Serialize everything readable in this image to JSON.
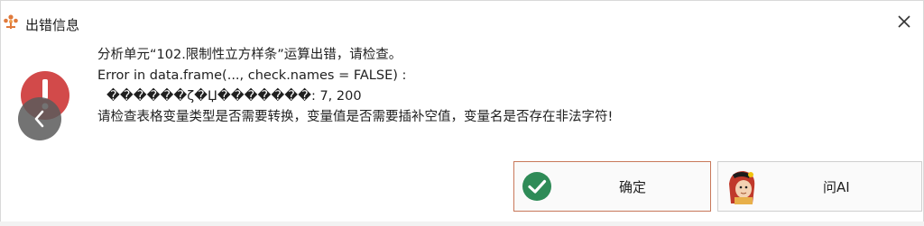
{
  "window": {
    "title": "出错信息"
  },
  "icons": {
    "app": "app-logo-icon",
    "close": "close-icon",
    "error": "error-icon",
    "ok": "checkmark-icon",
    "ai": "mascot-icon"
  },
  "message": {
    "line1": "分析单元“102.限制性立方样条”运算出错，请检查。",
    "line2": "Error in data.frame(..., check.names = FALSE) :",
    "line3": "������ζ�Џ�������: 7, 200",
    "line4": "请检查表格变量类型是否需要转换，变量值是否需要插补空值，变量名是否存在非法字符!"
  },
  "buttons": {
    "ok_label": "确定",
    "ai_label": "问AI"
  },
  "colors": {
    "error_red": "#d24a4a",
    "ok_green": "#2e8b57",
    "ok_border": "#c8785a",
    "brand_orange": "#e07a3c"
  }
}
